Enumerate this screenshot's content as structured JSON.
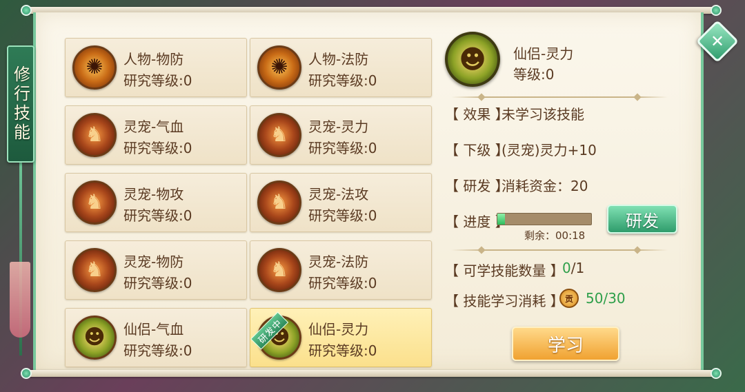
{
  "side_title": "修行技能",
  "close_symbol": "✕",
  "cards": [
    {
      "name": "人物-物防",
      "level": "研究等级:0",
      "icon": "person-armor-icon"
    },
    {
      "name": "人物-法防",
      "level": "研究等级:0",
      "icon": "person-magic-icon"
    },
    {
      "name": "灵宠-气血",
      "level": "研究等级:0",
      "icon": "fox-icon"
    },
    {
      "name": "灵宠-灵力",
      "level": "研究等级:0",
      "icon": "fox-icon"
    },
    {
      "name": "灵宠-物攻",
      "level": "研究等级:0",
      "icon": "fox-icon"
    },
    {
      "name": "灵宠-法攻",
      "level": "研究等级:0",
      "icon": "fox-icon"
    },
    {
      "name": "灵宠-物防",
      "level": "研究等级:0",
      "icon": "fox-icon"
    },
    {
      "name": "灵宠-法防",
      "level": "研究等级:0",
      "icon": "fox-icon"
    },
    {
      "name": "仙侣-气血",
      "level": "研究等级:0",
      "icon": "couple-icon"
    },
    {
      "name": "仙侣-灵力",
      "level": "研究等级:0",
      "icon": "couple-icon",
      "ribbon": "研发中",
      "selected": true
    }
  ],
  "detail": {
    "name": "仙侣-灵力",
    "level": "等级:0",
    "effect_label": "【 效果 】",
    "effect_value": "未学习该技能",
    "next_label": "【 下级 】",
    "next_value": "(灵宠)灵力+10",
    "research_label": "【 研发 】",
    "research_value": "消耗资金：20",
    "progress_label": "【 进度 】",
    "progress_fraction": 0.08,
    "remaining": "剩余：00:18",
    "research_button": "研发",
    "learnable_label": "【 可学技能数量 】",
    "learnable_current": "0",
    "learnable_total": "/1",
    "cost_label": "【 技能学习消耗 】",
    "cost_coin": "贡",
    "cost_value": "50/30",
    "learn_button": "学习"
  },
  "colors": {
    "accent_green": "#2e9f4a",
    "text_brown": "#5a3a22",
    "selected_card": "#fbe08c"
  }
}
